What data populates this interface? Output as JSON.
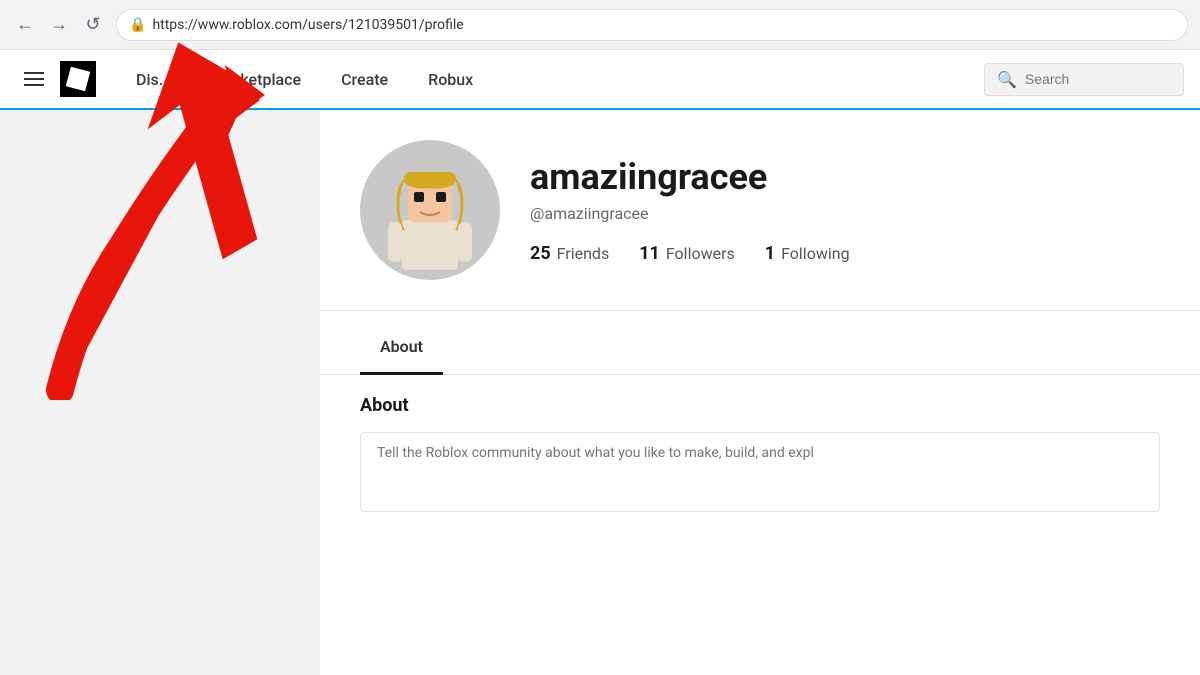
{
  "browser": {
    "back_btn": "←",
    "forward_btn": "→",
    "reload_btn": "↺",
    "url": "https://www.roblox.com/users/121039501/profile",
    "url_domain": "roblox.com",
    "url_path": "/users/121039501/profile"
  },
  "navbar": {
    "hamburger_label": "Menu",
    "logo_label": "Roblox Logo",
    "discover_label": "Dis...",
    "marketplace_label": "Marketplace",
    "create_label": "Create",
    "robux_label": "Robux",
    "search_placeholder": "Search"
  },
  "profile": {
    "username": "amaziingracee",
    "handle": "@amaziingracee",
    "stats": {
      "friends_count": "25",
      "friends_label": "Friends",
      "followers_count": "11",
      "followers_label": "Followers",
      "following_count": "1",
      "following_label": "Following"
    }
  },
  "tabs": {
    "items": [
      {
        "label": "About",
        "active": true
      }
    ]
  },
  "about": {
    "title": "About",
    "textarea_placeholder": "Tell the Roblox community about what you like to make, build, and expl"
  },
  "arrow": {
    "color": "#e8150a"
  }
}
